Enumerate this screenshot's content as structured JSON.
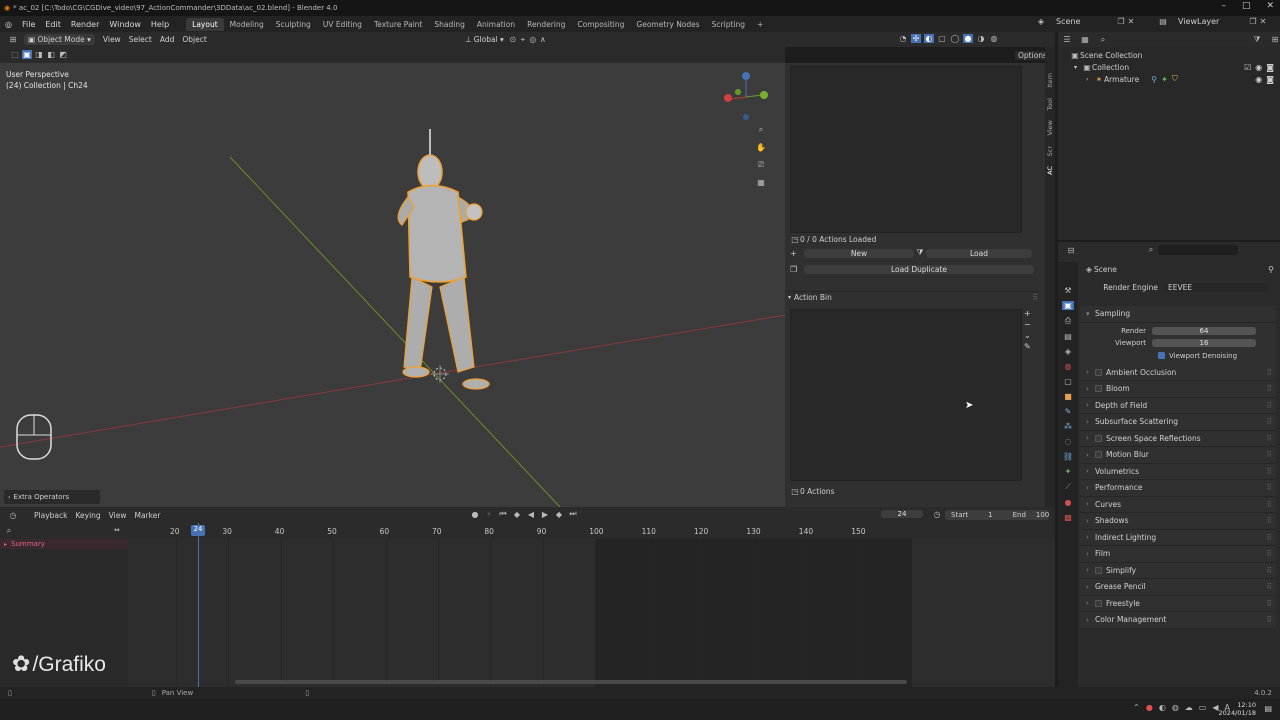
{
  "titlebar": {
    "title": "* ac_02 [C:\\Todo\\CG\\CGDive_video\\97_ActionCommander\\3DData\\ac_02.blend] - Blender 4.0"
  },
  "menu": [
    "File",
    "Edit",
    "Render",
    "Window",
    "Help"
  ],
  "workspaces": [
    "Layout",
    "Modeling",
    "Sculpting",
    "UV Editing",
    "Texture Paint",
    "Shading",
    "Animation",
    "Rendering",
    "Compositing",
    "Geometry Nodes",
    "Scripting"
  ],
  "active_workspace": "Layout",
  "scene": {
    "scene_name": "Scene",
    "view_layer": "ViewLayer"
  },
  "viewport": {
    "mode": "Object Mode",
    "menus": [
      "View",
      "Select",
      "Add",
      "Object"
    ],
    "orientation": "Global",
    "options_label": "Options",
    "overlay_title": "User Perspective",
    "overlay_sub": "(24) Collection | Ch24",
    "extra_ops": "Extra Operators",
    "side_tabs": [
      "Item",
      "Tool",
      "View",
      "Scr",
      "AC"
    ]
  },
  "action_panel": {
    "actions_loaded": "0 / 0 Actions Loaded",
    "new_label": "New",
    "load_label": "Load",
    "load_duplicate": "Load Duplicate",
    "bin_title": "Action Bin",
    "actions_count": "0 Actions"
  },
  "outliner": {
    "scene_collection": "Scene Collection",
    "collection": "Collection",
    "armature": "Armature"
  },
  "properties": {
    "scene_label": "Scene",
    "render_engine_label": "Render Engine",
    "render_engine": "EEVEE",
    "sampling": "Sampling",
    "render_label": "Render",
    "render_value": "64",
    "viewport_label": "Viewport",
    "viewport_value": "16",
    "viewport_denoising": "Viewport Denoising",
    "panels": [
      {
        "label": "Ambient Occlusion",
        "check": true
      },
      {
        "label": "Bloom",
        "check": true
      },
      {
        "label": "Depth of Field",
        "check": false
      },
      {
        "label": "Subsurface Scattering",
        "check": false
      },
      {
        "label": "Screen Space Reflections",
        "check": true
      },
      {
        "label": "Motion Blur",
        "check": true
      },
      {
        "label": "Volumetrics",
        "check": false
      },
      {
        "label": "Performance",
        "check": false
      },
      {
        "label": "Curves",
        "check": false
      },
      {
        "label": "Shadows",
        "check": false
      },
      {
        "label": "Indirect Lighting",
        "check": false
      },
      {
        "label": "Film",
        "check": false
      },
      {
        "label": "Simplify",
        "check": true
      },
      {
        "label": "Grease Pencil",
        "check": false
      },
      {
        "label": "Freestyle",
        "check": true
      },
      {
        "label": "Color Management",
        "check": false
      }
    ]
  },
  "timeline": {
    "menus": [
      "Playback",
      "Keying",
      "View",
      "Marker"
    ],
    "current_frame": "24",
    "start_label": "Start",
    "start_value": "1",
    "end_label": "End",
    "end_value": "100",
    "ticks": [
      "20",
      "30",
      "40",
      "50",
      "60",
      "70",
      "80",
      "90",
      "100",
      "110",
      "120",
      "130",
      "140",
      "150"
    ],
    "summary": "Summary"
  },
  "status": {
    "pan_view": "Pan View",
    "version": "4.0.2"
  },
  "watermark": "/Grafiko",
  "taskbar": {
    "time": "12:10",
    "date": "2024/01/18"
  },
  "colors": {
    "accent": "#4772b3",
    "selection_outline": "#f0a030",
    "current_frame": "#4772b3"
  }
}
